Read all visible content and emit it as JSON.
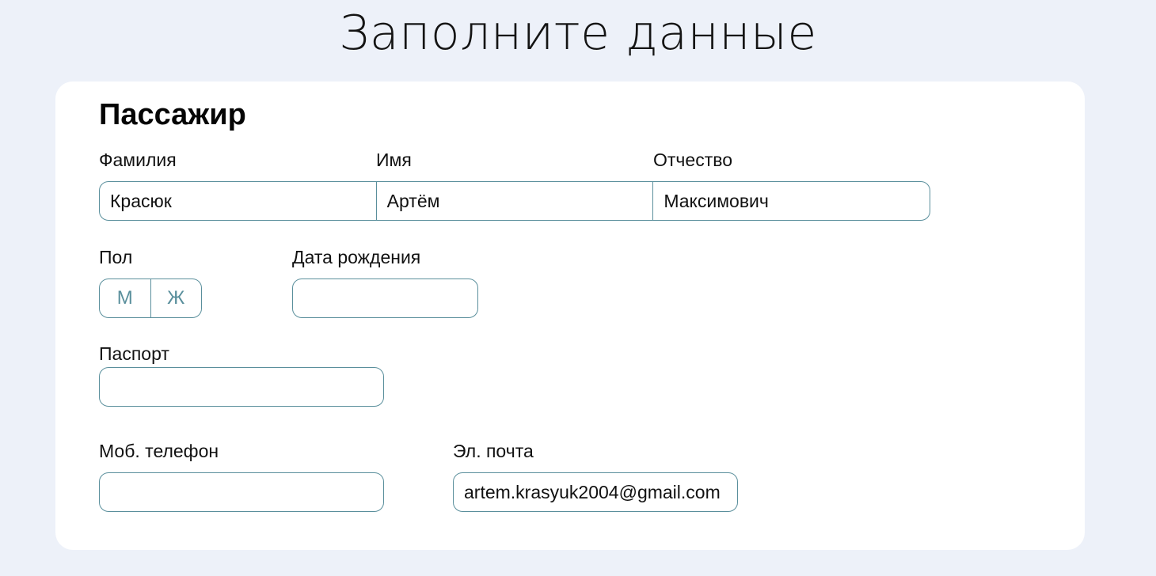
{
  "page": {
    "title": "Заполните данные"
  },
  "passenger": {
    "section_title": "Пассажир",
    "surname": {
      "label": "Фамилия",
      "value": "Красюк"
    },
    "first_name": {
      "label": "Имя",
      "value": "Артём"
    },
    "patronymic": {
      "label": "Отчество",
      "value": "Максимович"
    },
    "gender": {
      "label": "Пол",
      "options": [
        "М",
        "Ж"
      ]
    },
    "birth_date": {
      "label": "Дата рождения",
      "value": ""
    },
    "passport": {
      "label": "Паспорт",
      "value": ""
    },
    "phone": {
      "label": "Моб. телефон",
      "value": ""
    },
    "email": {
      "label": "Эл. почта",
      "value": "artem.krasyuk2004@gmail.com"
    }
  },
  "colors": {
    "background": "#edf1f9",
    "card": "#ffffff",
    "border_accent": "#5a8f9c"
  }
}
